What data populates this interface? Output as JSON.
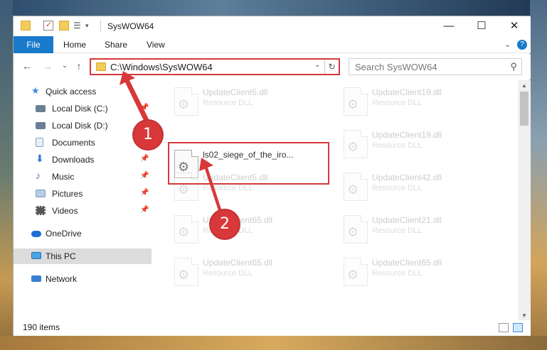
{
  "window": {
    "title": "SysWOW64",
    "controls": {
      "minimize": "—",
      "maximize": "☐",
      "close": "✕"
    }
  },
  "ribbon": {
    "tabs": [
      "File",
      "Home",
      "Share",
      "View"
    ],
    "expand": "⌄",
    "help": "?"
  },
  "address": {
    "path": "C:\\Windows\\SysWOW64",
    "dropdown": "⌄",
    "refresh": "↻"
  },
  "nav_buttons": {
    "back": "←",
    "forward": "→",
    "recent": "⌄",
    "up": "↑"
  },
  "search": {
    "placeholder": "Search SysWOW64",
    "icon": "⚲"
  },
  "sidebar": {
    "items": [
      {
        "label": "Quick access",
        "icon": "star-icon",
        "color": "#3b8de0"
      },
      {
        "label": "Local Disk (C:)",
        "icon": "drive-icon",
        "color": "#6b7f95",
        "pinned": true
      },
      {
        "label": "Local Disk (D:)",
        "icon": "drive-icon",
        "color": "#6b7f95",
        "pinned": false
      },
      {
        "label": "Documents",
        "icon": "documents-icon",
        "color": "#7ba4d0",
        "pinned": true
      },
      {
        "label": "Downloads",
        "icon": "download-icon",
        "color": "#2d78d6",
        "pinned": true
      },
      {
        "label": "Music",
        "icon": "music-icon",
        "color": "#3a6fc4",
        "pinned": true
      },
      {
        "label": "Pictures",
        "icon": "pictures-icon",
        "color": "#7a9bc4",
        "pinned": true
      },
      {
        "label": "Videos",
        "icon": "videos-icon",
        "color": "#555555",
        "pinned": true
      },
      {
        "label": "OneDrive",
        "icon": "cloud-icon",
        "color": "#1d6fd6"
      },
      {
        "label": "This PC",
        "icon": "computer-icon",
        "color": "#4aa3e6",
        "selected": true
      },
      {
        "label": "Network",
        "icon": "network-icon",
        "color": "#3a7fcf"
      }
    ],
    "pin_glyph": "📌"
  },
  "files": {
    "left": [
      {
        "name": "UpdateClient5.dll",
        "type": "Resource DLL"
      },
      {
        "name": "ls02_siege_of_the_iro...",
        "type": "",
        "highlighted": true
      },
      {
        "name": "UpdateClient5.dll",
        "type": "Resource DLL"
      },
      {
        "name": "UpdateClient65.dll",
        "type": "Resource DLL"
      },
      {
        "name": "UpdateClient65.dll",
        "type": "Resource DLL"
      }
    ],
    "right": [
      {
        "name": "UpdateClient19.dll",
        "type": "Resource DLL"
      },
      {
        "name": "UpdateClient19.dll",
        "type": "Resource DLL"
      },
      {
        "name": "UpdateClient42.dll",
        "type": "Resource DLL"
      },
      {
        "name": "UpdateClient21.dll",
        "type": "Resource DLL"
      },
      {
        "name": "UpdateClient65.dll",
        "type": "Resource DLL"
      }
    ]
  },
  "status": {
    "count": "190 items"
  },
  "annotations": {
    "badge1": "1",
    "badge2": "2",
    "color": "#d8383a"
  }
}
